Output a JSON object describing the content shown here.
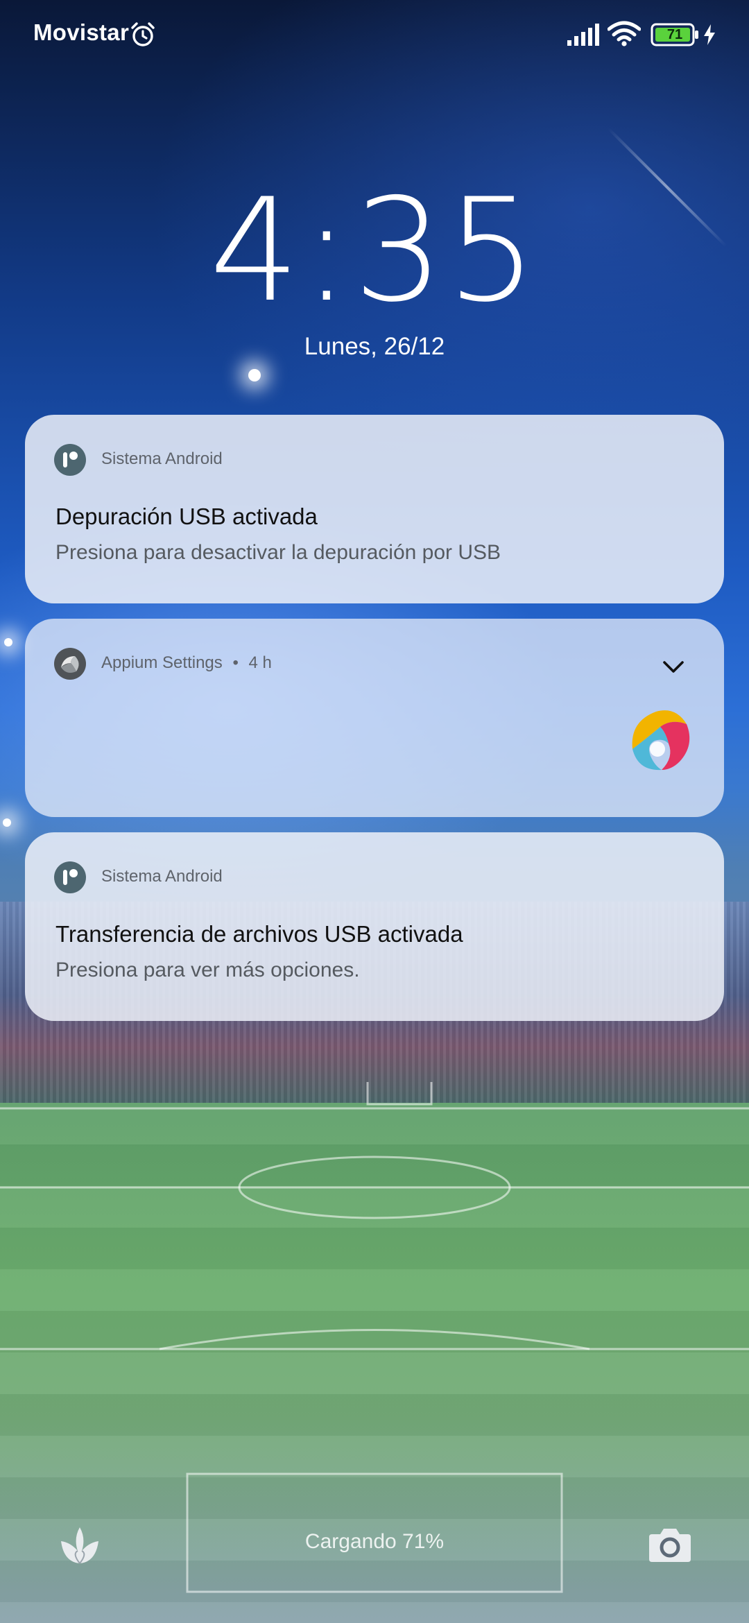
{
  "status_bar": {
    "carrier": "Movistar",
    "battery_level": "71",
    "icons": [
      "alarm-icon",
      "signal-icon",
      "wifi-icon",
      "battery-icon",
      "charging-bolt-icon"
    ]
  },
  "lock_screen": {
    "time": "4:35",
    "date": "Lunes, 26/12"
  },
  "notifications": [
    {
      "app_name": "Sistema Android",
      "title": "Depuración USB activada",
      "text": "Presiona para desactivar la depuración por USB",
      "icon": "android-system-icon"
    },
    {
      "app_name": "Appium Settings",
      "time_ago": "4 h",
      "separator": "•",
      "icon": "appium-icon",
      "expand_icon": "chevron-down-icon"
    },
    {
      "app_name": "Sistema Android",
      "title": "Transferencia de archivos USB activada",
      "text": "Presiona para ver más opciones.",
      "icon": "android-system-icon"
    }
  ],
  "bottom": {
    "charging_text": "Cargando 71%",
    "left_shortcut_icon": "tulip-icon",
    "right_shortcut_icon": "camera-icon"
  },
  "colors": {
    "battery_fill": "#5ad23c",
    "notification_bg": "#eef1f8",
    "text_primary": "#111111",
    "text_secondary": "#555a60"
  }
}
